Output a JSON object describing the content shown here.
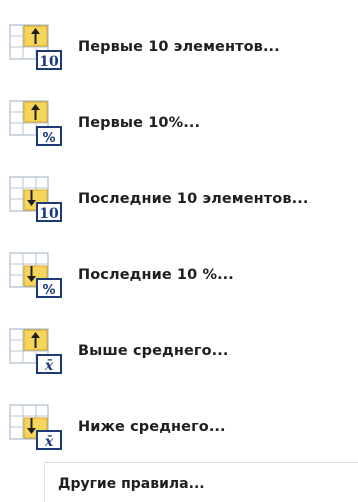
{
  "menu": {
    "items": [
      {
        "label": "Первые 10 элементов...",
        "icon": "top-10-items-icon",
        "badge": "10"
      },
      {
        "label": "Первые 10%...",
        "icon": "top-10-percent-icon",
        "badge": "%"
      },
      {
        "label": "Последние 10 элементов...",
        "icon": "bottom-10-items-icon",
        "badge": "10"
      },
      {
        "label": "Последние 10 %...",
        "icon": "bottom-10-percent-icon",
        "badge": "%"
      },
      {
        "label": "Выше среднего...",
        "icon": "above-average-icon",
        "badge": "x̄"
      },
      {
        "label": "Ниже среднего...",
        "icon": "below-average-icon",
        "badge": "x̄"
      }
    ],
    "other_rules_label": "Другие правила..."
  },
  "colors": {
    "icon_gold": "#f6d65a",
    "icon_grid": "#a9b7c9",
    "icon_blue": "#1d3a78",
    "text": "#1f1f1f",
    "separator": "#dcdcdc"
  }
}
